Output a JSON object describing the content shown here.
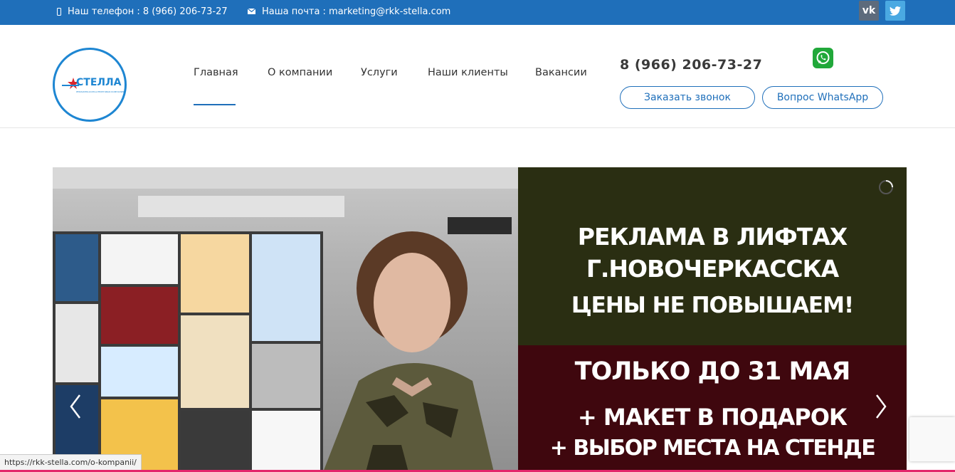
{
  "topbar": {
    "phone_text": "Наш телефон : 8 (966) 206-73-27",
    "email_text": "Наша почта : marketing@rkk-stella.com",
    "vk_label": "vk",
    "icons": {
      "phone": "phone-icon",
      "email": "mail-icon",
      "vk": "vk-icon",
      "twitter": "twitter-icon"
    }
  },
  "logo": {
    "text": "СТЕЛЛА",
    "subtitle": "РЕКЛАМНО-КОНСАЛТИНГОВАЯ КОМПАНИЯ"
  },
  "nav": {
    "items": [
      {
        "label": "Главная",
        "active": true
      },
      {
        "label": "О компании"
      },
      {
        "label": "Услуги"
      },
      {
        "label": "Наши клиенты"
      },
      {
        "label": "Вакансии"
      }
    ]
  },
  "header": {
    "phone": "8 (966) 206-73-27",
    "callback_button": "Заказать звонок",
    "whatsapp_button": "Вопрос WhatsApp",
    "whatsapp_icon": "whatsapp-icon"
  },
  "banner": {
    "promo_lines": [
      "РЕКЛАМА В ЛИФТАХ",
      "Г.НОВОЧЕРКАССКА",
      "ЦЕНЫ НЕ ПОВЫШАЕМ!",
      "ТОЛЬКО ДО 31 МАЯ",
      "+ МАКЕТ  В ПОДАРОК",
      "+ ВЫБОР МЕСТА НА СТЕНДЕ"
    ],
    "next_icon": "chevron-right-icon",
    "prev_icon": "chevron-left-icon"
  },
  "status_url": "https://rkk-stella.com/o-kompanii/",
  "colors": {
    "topbar": "#1f6fba",
    "accent": "#1f6fba",
    "promo_top": "#2a2e12",
    "promo_bottom": "#3f070e",
    "whatsapp": "#21a83a"
  }
}
